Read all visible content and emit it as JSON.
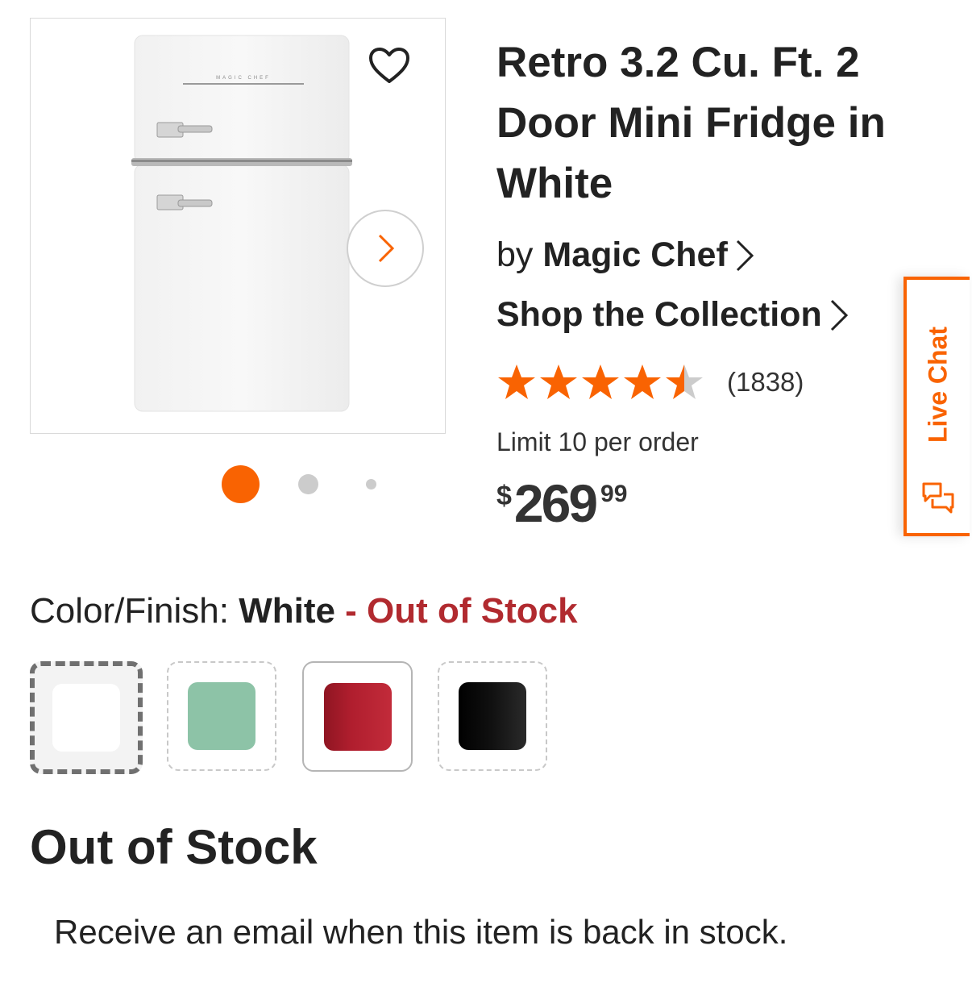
{
  "product": {
    "title": "Retro 3.2 Cu. Ft. 2 Door Mini Fridge in White",
    "by_prefix": "by",
    "brand": "Magic Chef",
    "collection_link": "Shop the Collection",
    "rating": 4.5,
    "review_count": "(1838)",
    "limit_text": "Limit 10 per order",
    "price": {
      "currency": "$",
      "dollars": "269",
      "cents": "99"
    }
  },
  "gallery": {
    "image_label": "MAGIC CHEF",
    "image_count": 3,
    "active_index": 0
  },
  "live_chat": {
    "label": "Live Chat"
  },
  "color": {
    "label": "Color/Finish: ",
    "selected": "White",
    "status": " - Out of Stock",
    "swatches": [
      {
        "name": "White",
        "color": "#ffffff"
      },
      {
        "name": "Mint",
        "color": "#8dc3a7"
      },
      {
        "name": "Red",
        "color": "#b01e2e"
      },
      {
        "name": "Black",
        "color": "#111111"
      }
    ]
  },
  "stock": {
    "heading": "Out of Stock",
    "email_note": "Receive an email when this item is back in stock."
  },
  "colors": {
    "accent": "#f96302",
    "out_of_stock": "#b12a2f",
    "text": "#222222"
  }
}
